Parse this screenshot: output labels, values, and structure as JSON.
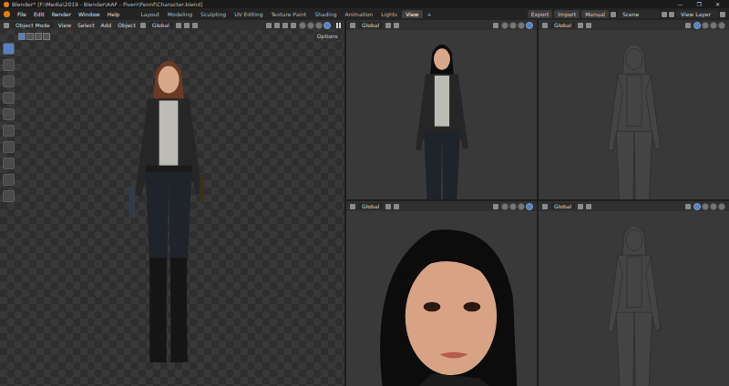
{
  "window": {
    "title": "Blender* [F:\\Media\\2019 - Blender\\AAF - Fiverr\\Fennf\\Character.blend]",
    "controls": [
      "—",
      "❐",
      "✕"
    ]
  },
  "menu": [
    "File",
    "Edit",
    "Render",
    "Window",
    "Help"
  ],
  "workspaces": [
    {
      "label": "Layout",
      "selected": false
    },
    {
      "label": "Modeling",
      "selected": false
    },
    {
      "label": "Sculpting",
      "selected": false
    },
    {
      "label": "UV Editing",
      "selected": false
    },
    {
      "label": "Texture Paint",
      "selected": false
    },
    {
      "label": "Shading",
      "selected": false
    },
    {
      "label": "Animation",
      "selected": false
    },
    {
      "label": "Lights",
      "selected": false
    },
    {
      "label": "View",
      "selected": true
    }
  ],
  "add_workspace": "+",
  "top_right": {
    "buttons": [
      "Export",
      "Import",
      "Manual"
    ],
    "scene": "Scene",
    "view_layer": "View Layer"
  },
  "main_viewport": {
    "mode": "Object Mode",
    "menus": [
      "View",
      "Select",
      "Add",
      "Object"
    ],
    "orientation": "Global",
    "options": "Options",
    "shading_modes": [
      {
        "selected": false
      },
      {
        "selected": false
      },
      {
        "selected": false
      },
      {
        "selected": true
      }
    ]
  },
  "sub_viewports": [
    {
      "orientation": "Global",
      "kind": "render",
      "shading_modes": [
        {
          "selected": false
        },
        {
          "selected": false
        },
        {
          "selected": false
        },
        {
          "selected": true
        }
      ]
    },
    {
      "orientation": "Global",
      "kind": "wireframe",
      "shading_modes": [
        {
          "selected": true
        },
        {
          "selected": false
        },
        {
          "selected": false
        },
        {
          "selected": false
        }
      ]
    },
    {
      "orientation": "Global",
      "kind": "closeup",
      "shading_modes": [
        {
          "selected": false
        },
        {
          "selected": false
        },
        {
          "selected": false
        },
        {
          "selected": true
        }
      ]
    },
    {
      "orientation": "Global",
      "kind": "wireframe",
      "shading_modes": [
        {
          "selected": true
        },
        {
          "selected": false
        },
        {
          "selected": false
        },
        {
          "selected": false
        }
      ]
    }
  ]
}
